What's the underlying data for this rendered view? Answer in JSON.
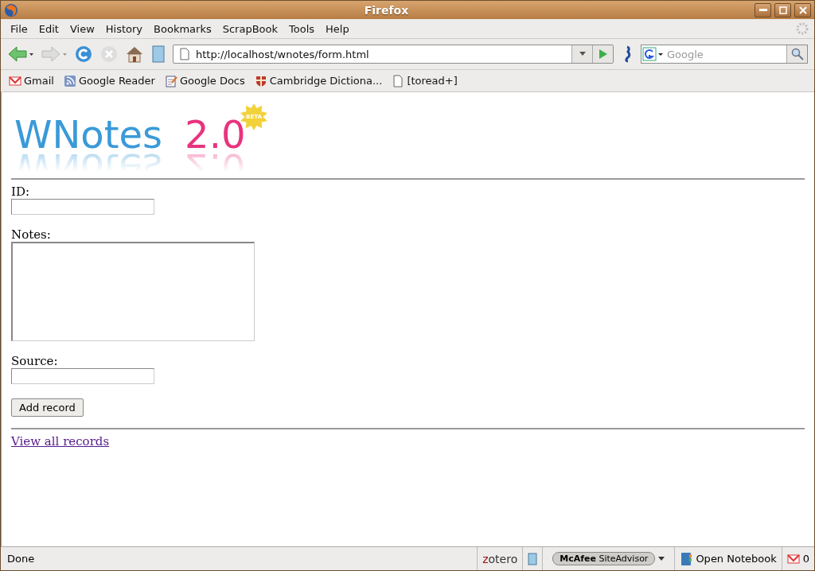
{
  "window": {
    "title": "Firefox"
  },
  "menu": [
    "File",
    "Edit",
    "View",
    "History",
    "Bookmarks",
    "ScrapBook",
    "Tools",
    "Help"
  ],
  "toolbar": {
    "url": "http://localhost/wnotes/form.html",
    "search_placeholder": "Google"
  },
  "bookmarks": [
    {
      "label": "Gmail",
      "kind": "mail"
    },
    {
      "label": "Google Reader",
      "kind": "feed"
    },
    {
      "label": "Google Docs",
      "kind": "doc"
    },
    {
      "label": "Cambridge Dictiona...",
      "kind": "shield"
    },
    {
      "label": "[toread+]",
      "kind": "page"
    }
  ],
  "logo": {
    "name": "WNotes",
    "version": "2.0",
    "badge": "BETA"
  },
  "form": {
    "fields": [
      {
        "label": "ID:",
        "kind": "input"
      },
      {
        "label": "Notes:",
        "kind": "textarea"
      },
      {
        "label": "Source:",
        "kind": "input"
      }
    ],
    "button": "Add record"
  },
  "link": "View all records",
  "status_bar": {
    "text": "Done",
    "zotero_z": "z",
    "zotero_rest": "otero",
    "siteadvisor_brand": "McAfee",
    "siteadvisor_product": "SiteAdvisor",
    "notebook": "Open Notebook",
    "mail_count": "0"
  }
}
